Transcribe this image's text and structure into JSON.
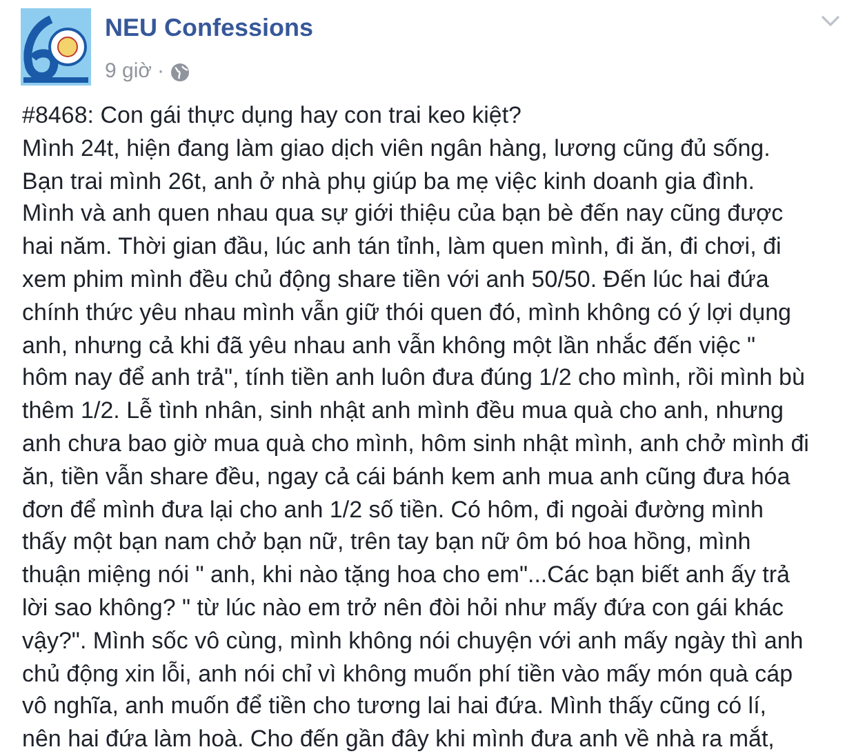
{
  "post": {
    "author": "NEU Confessions",
    "time": "9 giờ",
    "separator": "·",
    "title": "#8468: Con gái thực dụng hay con trai keo kiệt?",
    "lines": [
      "Mình 24t, hiện đang làm giao dịch viên ngân hàng, lương cũng đủ sống.",
      "Bạn trai mình 26t, anh ở nhà phụ giúp ba mẹ việc kinh doanh gia đình.",
      "Mình và anh quen nhau qua sự giới thiệu của bạn bè đến nay cũng được",
      "hai năm. Thời gian đầu, lúc anh tán tỉnh, làm quen mình, đi ăn, đi chơi, đi",
      "xem phim mình đều chủ động share tiền với anh 50/50. Đến lúc hai đứa",
      "chính thức yêu nhau mình vẫn giữ thói quen đó, mình không có ý lợi dụng",
      "anh, nhưng cả khi đã yêu nhau anh vẫn không một lần nhắc đến việc \"",
      "hôm nay để anh trả\", tính tiền anh luôn đưa đúng 1/2 cho mình, rồi mình bù",
      "thêm 1/2. Lễ tình nhân, sinh nhật anh mình đều mua quà cho anh, nhưng",
      "anh chưa bao giờ mua quà cho mình, hôm sinh nhật mình, anh chở mình đi",
      "ăn, tiền vẫn share đều, ngay cả cái bánh kem anh mua anh cũng đưa hóa",
      "đơn để mình đưa lại cho anh 1/2 số tiền. Có hôm, đi ngoài đường mình",
      "thấy một bạn nam chở bạn nữ, trên tay bạn nữ ôm bó hoa hồng, mình",
      "thuận miệng nói \" anh, khi nào tặng hoa cho em\"...Các bạn biết anh ấy trả",
      "lời sao không? \" từ lúc nào em trở nên đòi hỏi như mấy đứa con gái khác",
      "vậy?\". Mình sốc vô cùng, mình không nói chuyện với anh mấy ngày thì anh",
      "chủ động xin lỗi, anh nói chỉ vì không muốn phí tiền vào mấy món quà cáp",
      "vô nghĩa, anh muốn để tiền cho tương lai hai đứa. Mình thấy cũng có lí,",
      "nên hai đứa làm hoà. Cho đến gần đây khi mình đưa anh về nhà ra mắt,"
    ]
  }
}
